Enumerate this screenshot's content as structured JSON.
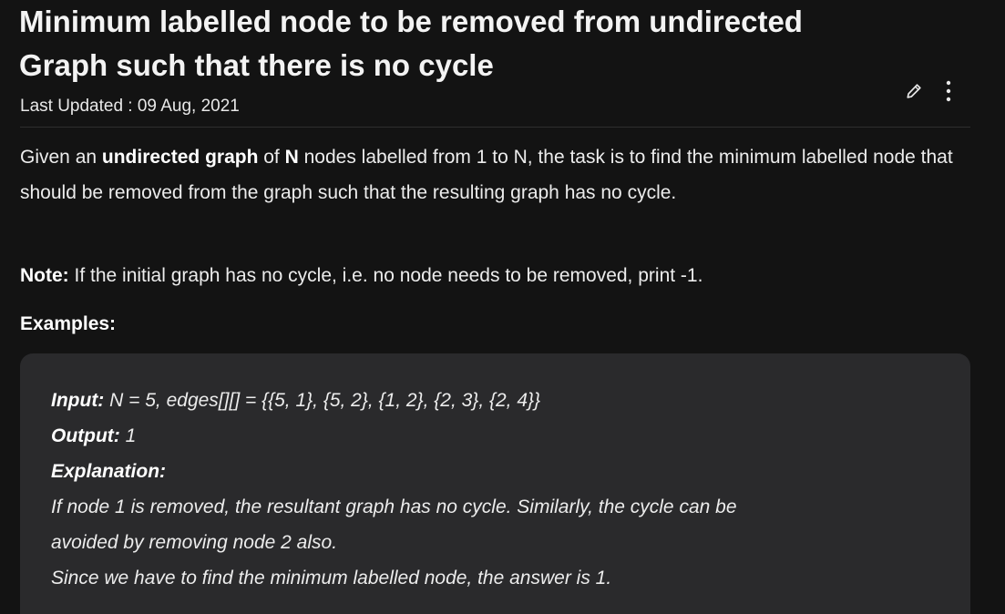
{
  "article": {
    "title": "Minimum labelled node to be removed from undirected Graph such that there is no cycle",
    "last_updated": "Last Updated : 09 Aug, 2021"
  },
  "icons": {
    "edit": "pencil-icon",
    "more": "more-vertical-icon"
  },
  "intro": {
    "part1": "Given an ",
    "bold1": "undirected graph",
    "part2": " of ",
    "bold2": "N",
    "part3": " nodes labelled from 1 to N, the task is to find the minimum labelled node that should be removed from the graph such that the resulting graph has no cycle."
  },
  "note": {
    "label": "Note:",
    "text": " If the initial graph has no cycle, i.e. no node needs to be removed, print -1."
  },
  "examples_heading": "Examples:",
  "example": {
    "input_label": "Input:",
    "input_text": " N = 5, edges[][] = {{5, 1}, {5, 2}, {1, 2}, {2, 3}, {2, 4}}",
    "output_label": "Output:",
    "output_text": " 1",
    "explanation_label": "Explanation:",
    "explanation_line1": "If node 1 is removed, the resultant graph has no cycle. Similarly, the cycle can be",
    "explanation_line2": "avoided by removing node 2 also.",
    "explanation_line3": "Since we have to find the minimum labelled node, the answer is 1."
  },
  "colors": {
    "background": "#131313",
    "example_box": "#2a2a2c",
    "text": "#ececec"
  }
}
